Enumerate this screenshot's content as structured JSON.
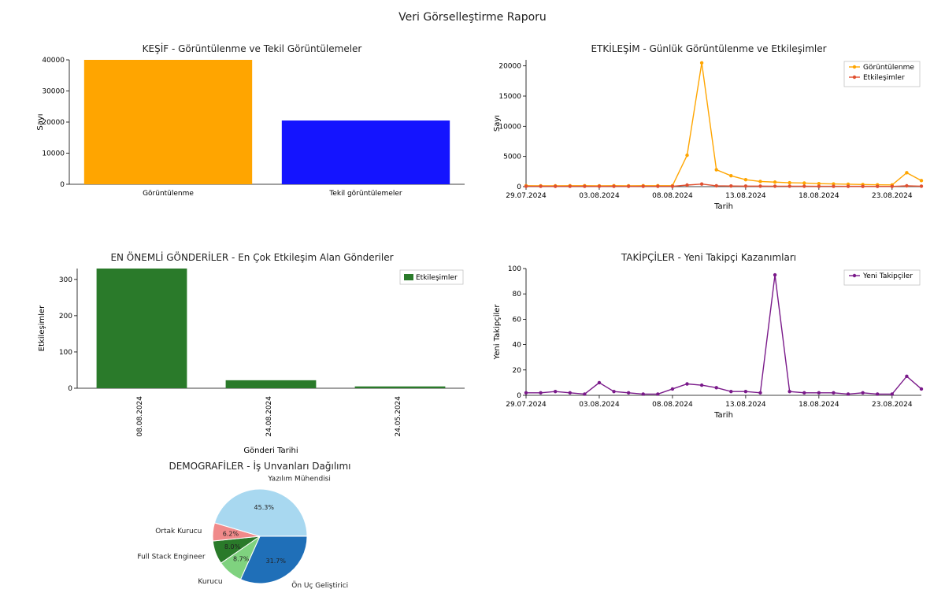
{
  "suptitle": "Veri Görselleştirme Raporu",
  "chart_data": [
    {
      "id": "kesif",
      "type": "bar",
      "title": "KEŞİF - Görüntülenme ve Tekil Görüntülemeler",
      "ylabel": "Sayı",
      "ylim": [
        0,
        40000
      ],
      "yticks": [
        0,
        10000,
        20000,
        30000,
        40000
      ],
      "categories": [
        "Görüntülenme",
        "Tekil görüntülemeler"
      ],
      "values": [
        40000,
        20500
      ],
      "colors": [
        "#ffa500",
        "#1414ff"
      ]
    },
    {
      "id": "etkilesim",
      "type": "line",
      "title": "ETKİLEŞİM - Günlük Görüntülenme ve Etkileşimler",
      "ylabel": "Sayı",
      "xlabel": "Tarih",
      "ylim": [
        0,
        21000
      ],
      "yticks": [
        0,
        5000,
        10000,
        15000,
        20000
      ],
      "xticks": [
        "29.07.2024",
        "03.08.2024",
        "08.08.2024",
        "13.08.2024",
        "18.08.2024",
        "23.08.2024"
      ],
      "series": [
        {
          "name": "Görüntülenme",
          "color": "#ffa500",
          "values": [
            150,
            140,
            130,
            160,
            150,
            140,
            150,
            140,
            150,
            160,
            160,
            5200,
            20500,
            2800,
            1800,
            1150,
            850,
            750,
            650,
            600,
            500,
            450,
            400,
            350,
            300,
            280,
            2300,
            1000
          ]
        },
        {
          "name": "Etkileşimler",
          "color": "#e05030",
          "values": [
            60,
            55,
            50,
            60,
            55,
            50,
            55,
            50,
            55,
            60,
            60,
            260,
            430,
            140,
            110,
            90,
            80,
            75,
            70,
            65,
            60,
            55,
            50,
            48,
            45,
            40,
            130,
            70
          ]
        }
      ]
    },
    {
      "id": "gonderiler",
      "type": "bar",
      "title": "EN ÖNEMLİ GÖNDERİLER - En Çok Etkileşim Alan Gönderiler",
      "ylabel": "Etkileşimler",
      "xlabel": "Gönderi Tarihi",
      "ylim": [
        0,
        330
      ],
      "yticks": [
        0,
        100,
        200,
        300
      ],
      "categories": [
        "08.08.2024",
        "24.08.2024",
        "24.05.2024"
      ],
      "values": [
        330,
        22,
        5
      ],
      "colors": [
        "#2a7a2a",
        "#2a7a2a",
        "#2a7a2a"
      ],
      "legend": "Etkileşimler"
    },
    {
      "id": "takipciler",
      "type": "line",
      "title": "TAKİPÇİLER - Yeni Takipçi Kazanımları",
      "ylabel": "Yeni Takipçiler",
      "xlabel": "Tarih",
      "ylim": [
        0,
        100
      ],
      "yticks": [
        0,
        20,
        40,
        60,
        80,
        100
      ],
      "xticks": [
        "29.07.2024",
        "03.08.2024",
        "08.08.2024",
        "13.08.2024",
        "18.08.2024",
        "23.08.2024"
      ],
      "series": [
        {
          "name": "Yeni Takipçiler",
          "color": "#7a1a8a",
          "values": [
            2,
            2,
            3,
            2,
            1,
            10,
            3,
            2,
            1,
            1,
            5,
            9,
            8,
            6,
            3,
            3,
            2,
            95,
            3,
            2,
            2,
            2,
            1,
            2,
            1,
            1,
            15,
            5
          ]
        }
      ]
    },
    {
      "id": "demografi",
      "type": "pie",
      "title": "DEMOGRAFİLER - İş Unvanları Dağılımı",
      "slices": [
        {
          "label": "Ön Uç Geliştirici",
          "pct": 31.7,
          "color": "#1f6fb8"
        },
        {
          "label": "Kurucu",
          "pct": 8.7,
          "color": "#7fd27f"
        },
        {
          "label": "Full Stack Engineer",
          "pct": 8.0,
          "color": "#2a7a2a"
        },
        {
          "label": "Ortak Kurucu",
          "pct": 6.2,
          "color": "#f08a8a"
        },
        {
          "label": "Yazılım Mühendisi",
          "pct": 45.3,
          "color": "#a8d8f0"
        }
      ]
    }
  ]
}
